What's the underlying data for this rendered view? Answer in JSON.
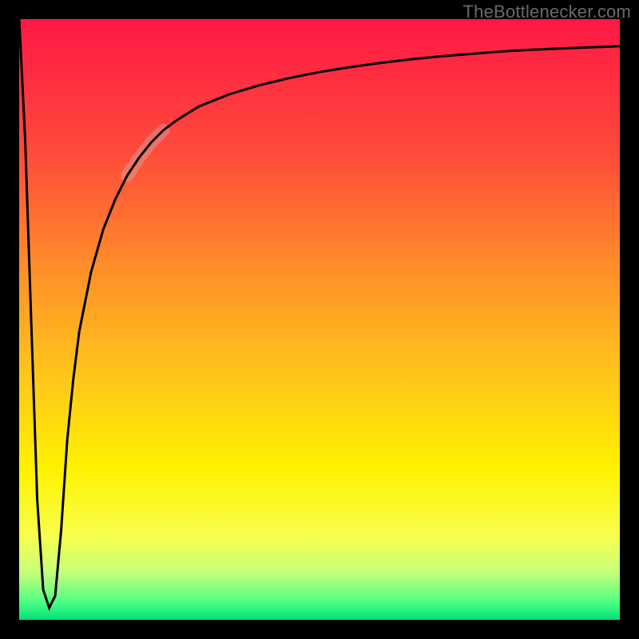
{
  "watermark": "TheBottlenecker.com",
  "chart_data": {
    "type": "line",
    "title": "",
    "xlabel": "",
    "ylabel": "",
    "xlim": [
      0,
      100
    ],
    "ylim": [
      0,
      100
    ],
    "x": [
      0,
      1,
      2,
      3,
      4,
      5,
      6,
      7,
      8,
      9,
      10,
      12,
      14,
      16,
      18,
      20,
      22,
      24,
      26,
      28,
      30,
      35,
      40,
      45,
      50,
      55,
      60,
      65,
      70,
      75,
      80,
      85,
      90,
      95,
      100
    ],
    "values": [
      100,
      80,
      50,
      20,
      5,
      2,
      4,
      15,
      30,
      40,
      48,
      58,
      65,
      70,
      74,
      77,
      79.5,
      81.5,
      83,
      84.3,
      85.5,
      87.5,
      89,
      90.2,
      91.2,
      92,
      92.7,
      93.3,
      93.8,
      94.2,
      94.6,
      94.9,
      95.1,
      95.3,
      95.5
    ],
    "highlight_segment": {
      "x_start": 18,
      "x_end": 24,
      "opacity": 0.35,
      "color": "#c9c0c2"
    },
    "gradient_stops": [
      {
        "offset": 0.0,
        "color": "#ff1845"
      },
      {
        "offset": 0.22,
        "color": "#ff4a3a"
      },
      {
        "offset": 0.45,
        "color": "#ff9a26"
      },
      {
        "offset": 0.6,
        "color": "#ffc81a"
      },
      {
        "offset": 0.75,
        "color": "#fff200"
      },
      {
        "offset": 0.86,
        "color": "#f7ff4c"
      },
      {
        "offset": 0.92,
        "color": "#c7ff7a"
      },
      {
        "offset": 0.97,
        "color": "#4eff85"
      },
      {
        "offset": 1.0,
        "color": "#00e07a"
      }
    ],
    "curve_color": "#000000",
    "curve_width": 3,
    "frame_thickness": 24
  }
}
